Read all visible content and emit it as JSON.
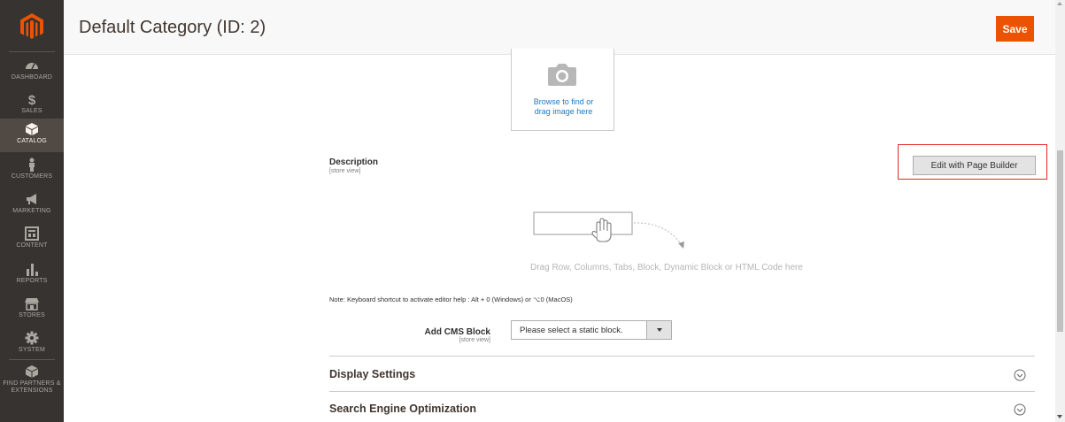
{
  "header": {
    "title": "Default Category (ID: 2)",
    "save_label": "Save"
  },
  "sidebar": {
    "logo": "magento-logo",
    "items": [
      {
        "label": "DASHBOARD",
        "icon": "dashboard-icon"
      },
      {
        "label": "SALES",
        "icon": "dollar-icon"
      },
      {
        "label": "CATALOG",
        "icon": "box-icon",
        "active": true
      },
      {
        "label": "CUSTOMERS",
        "icon": "person-icon"
      },
      {
        "label": "MARKETING",
        "icon": "megaphone-icon"
      },
      {
        "label": "CONTENT",
        "icon": "layout-icon"
      },
      {
        "label": "REPORTS",
        "icon": "bar-chart-icon"
      },
      {
        "label": "STORES",
        "icon": "store-icon"
      },
      {
        "label": "SYSTEM",
        "icon": "gear-icon"
      },
      {
        "label": "FIND PARTNERS & EXTENSIONS",
        "icon": "cube-icon"
      }
    ]
  },
  "image_upload": {
    "text": "Browse to find or drag image here"
  },
  "description": {
    "label": "Description",
    "scope": "[store view]",
    "page_builder_button": "Edit with Page Builder",
    "drop_hint": "Drag Row, Columns, Tabs, Block, Dynamic Block or HTML Code here",
    "note": "Note: Keyboard shortcut to activate editor help : Alt + 0 (Windows) or ⌥0 (MacOS)"
  },
  "cms_block": {
    "label": "Add CMS Block",
    "scope": "[store view]",
    "selected": "Please select a static block."
  },
  "sections": [
    {
      "title": "Display Settings"
    },
    {
      "title": "Search Engine Optimization"
    }
  ],
  "colors": {
    "accent": "#eb5202",
    "sidebar_bg": "#373330",
    "highlight": "#e02b27",
    "link": "#1979c3"
  }
}
